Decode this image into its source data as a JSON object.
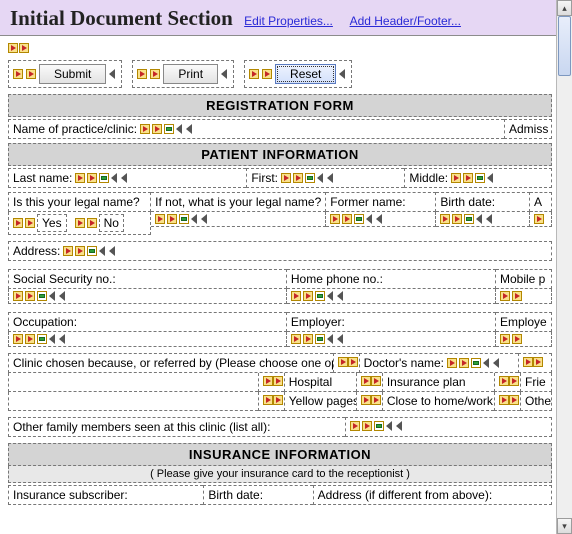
{
  "header": {
    "title": "Initial Document Section",
    "link_edit": "Edit Properties...",
    "link_hf": "Add Header/Footer..."
  },
  "toolbar": {
    "submit": "Submit",
    "print": "Print",
    "reset": "Reset"
  },
  "form": {
    "reg_title": "REGISTRATION FORM",
    "practice_label": "Name of practice/clinic:",
    "admission_label": "Admiss",
    "patient_title": "PATIENT INFORMATION",
    "last_name": "Last name:",
    "first_name": "First:",
    "middle_name": "Middle:",
    "legal_q": "Is this your legal name?",
    "legal_if_not": "If not, what is your legal name?",
    "former": "Former name:",
    "birth": "Birth date:",
    "age_trunc": "A",
    "yes": "Yes",
    "no": "No",
    "address": "Address:",
    "ssn": "Social Security no.:",
    "home_phone": "Home phone no.:",
    "mobile_trunc": "Mobile p",
    "occupation": "Occupation:",
    "employer": "Employer:",
    "employer_trunc": "Employe",
    "clinic_reason": "Clinic chosen because, or referred by (Please choose one option):",
    "doctor_name": "Doctor's name:",
    "hospital": "Hospital",
    "insurance_plan": "Insurance plan",
    "friend_trunc": "Frie",
    "yellow_pages": "Yellow pages",
    "close_home": "Close to home/work",
    "other_trunc": "Othe",
    "other_family": "Other family members seen at this clinic (list all):",
    "insurance_title": "INSURANCE INFORMATION",
    "insurance_sub": "( Please give your insurance card to the receptionist )",
    "ins_subscriber": "Insurance subscriber:",
    "ins_birth": "Birth date:",
    "ins_address": "Address (if different from above):"
  }
}
